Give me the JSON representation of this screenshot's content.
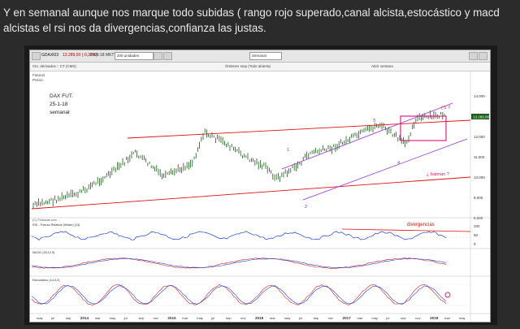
{
  "post": {
    "text": "Y en semanal aunque nos marque todo subidas ( rango rojo superado,canal alcista,estocástico y macd alcistas el rsi nos da divergencias,confianza las justas."
  },
  "app": {
    "instrument": "GDAXI03",
    "quote_change": "13.289,00 (-0,32%)",
    "quote_tail": "IN09:18 MKTVFDB18 Futuro",
    "period_label": "200 unidades",
    "timeframe_label": "Semanal",
    "panel_title": "Cts. derivados :: CT (CMS)",
    "panel_sub1": "Futuros",
    "panel_sub2": "Precio",
    "center_label": "Órdenes stop (Todo abierta)",
    "right_label": "Abrir ventana"
  },
  "annotations": {
    "title1": "DAX FUT.",
    "title2": "25-1-18",
    "title3": "semanal",
    "wave1": "1",
    "wave2": "2",
    "wave3": "3",
    "wave4": "4",
    "wave5": "( 5 ?",
    "batman": "¿ batman ?",
    "divergencias": "divergencias"
  },
  "indicators": {
    "source": "(C) Finanzas.com ...",
    "rsi": "RSI - Fuerza Relativa (Wilder) (14)",
    "macd": "MACD (26,12,9)",
    "stoch": "Estocástico (14,3,3)"
  },
  "price_axis": [
    "14.000",
    "13.000",
    "12.000",
    "11.000",
    "10.000",
    "9.000",
    "8.000"
  ],
  "last_price": "13.289,00",
  "rsi_axis": [
    "100",
    "50",
    "0"
  ],
  "time_axis": [
    "may",
    "jul",
    "sep",
    "2014",
    "mar",
    "may",
    "jul",
    "sep",
    "nov",
    "2015",
    "mar",
    "may",
    "jul",
    "sep",
    "nov",
    "2016",
    "mar",
    "may",
    "jul",
    "sep",
    "nov",
    "2017",
    "mar",
    "may",
    "jul",
    "sep",
    "nov",
    "2018",
    "mar",
    "may"
  ],
  "colors": {
    "price_bar": "#1a5c1a",
    "trendline": "#e01010",
    "channel": "#9b30d0",
    "annotation": "#d0206a",
    "rsi": "#2040d0",
    "macd": "#d02020",
    "macd_signal": "#2040d0",
    "stoch_k": "#d02020",
    "stoch_d": "#2040d0"
  }
}
